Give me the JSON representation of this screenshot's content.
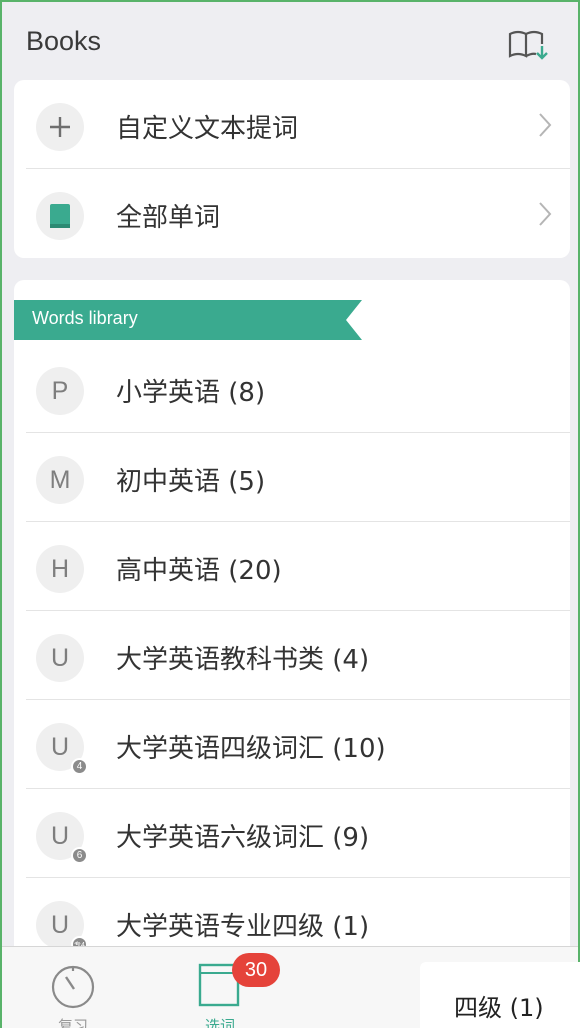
{
  "header": {
    "title": "Books"
  },
  "top_items": [
    {
      "icon": "plus-icon",
      "label": "自定义文本提词"
    },
    {
      "icon": "book-icon",
      "label": "全部单词"
    }
  ],
  "library": {
    "ribbon": "Words library",
    "items": [
      {
        "letter": "P",
        "sub": "",
        "label": "小学英语 (8)"
      },
      {
        "letter": "M",
        "sub": "",
        "label": "初中英语 (5)"
      },
      {
        "letter": "H",
        "sub": "",
        "label": "高中英语 (20)"
      },
      {
        "letter": "U",
        "sub": "",
        "label": "大学英语教科书类 (4)"
      },
      {
        "letter": "U",
        "sub": "4",
        "label": "大学英语四级词汇 (10)"
      },
      {
        "letter": "U",
        "sub": "6",
        "label": "大学英语六级词汇 (9)"
      },
      {
        "letter": "U",
        "sub": "专4",
        "label": "大学英语专业四级 (1)"
      }
    ]
  },
  "tabbar": {
    "tabs": [
      {
        "label": "复习",
        "icon": "timer-icon"
      },
      {
        "label": "选词",
        "icon": "card-icon"
      }
    ],
    "badge": "30"
  },
  "popup": {
    "text": "四级 (1)"
  },
  "colors": {
    "accent": "#3aaa8f",
    "badge": "#e5433a"
  }
}
